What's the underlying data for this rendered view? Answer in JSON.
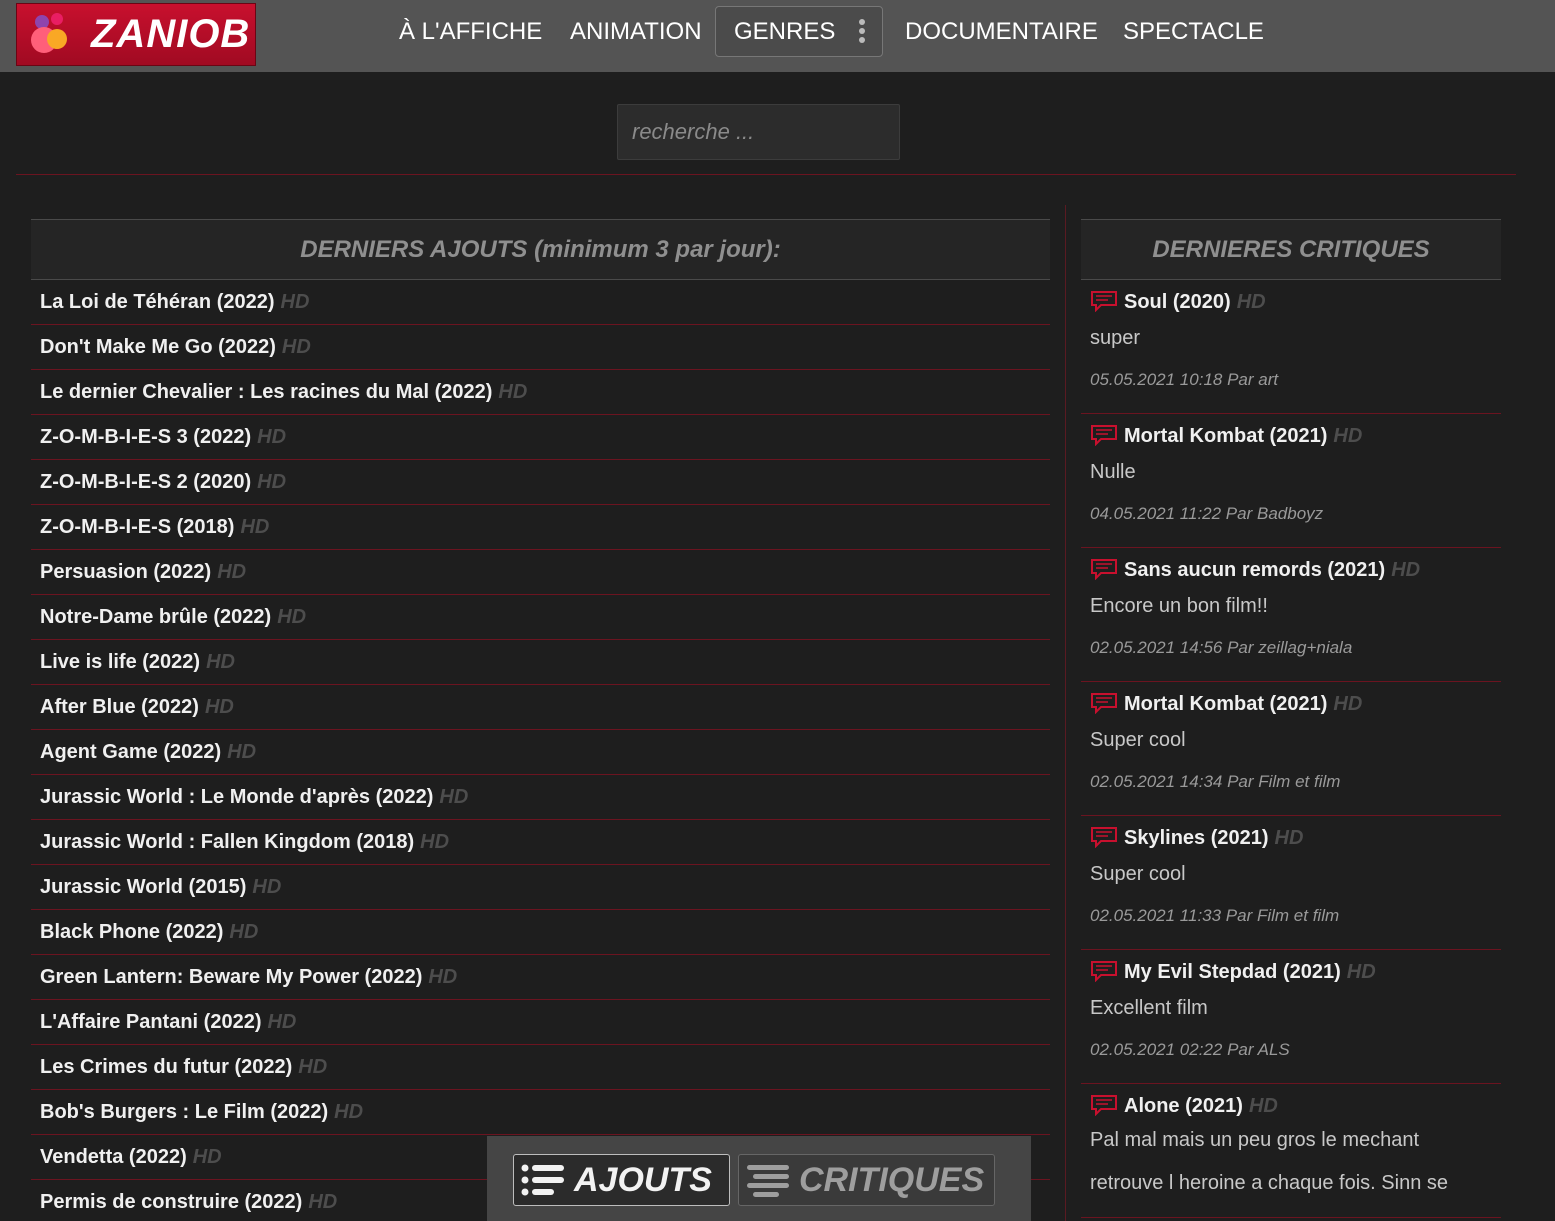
{
  "brand": {
    "name": "ZANIOB"
  },
  "nav": {
    "affiche": "À L'AFFICHE",
    "animation": "ANIMATION",
    "genres": "GENRES",
    "documentaire": "DOCUMENTAIRE",
    "spectacle": "SPECTACLE"
  },
  "search": {
    "placeholder": "recherche ..."
  },
  "additions": {
    "heading": "DERNIERS AJOUTS (minimum 3 par jour):",
    "items": [
      {
        "title": "La Loi de Téhéran (2022)",
        "quality": "HD"
      },
      {
        "title": "Don't Make Me Go (2022)",
        "quality": "HD"
      },
      {
        "title": "Le dernier Chevalier : Les racines du Mal (2022)",
        "quality": "HD"
      },
      {
        "title": "Z-O-M-B-I-E-S 3 (2022)",
        "quality": "HD"
      },
      {
        "title": "Z-O-M-B-I-E-S 2 (2020)",
        "quality": "HD"
      },
      {
        "title": "Z-O-M-B-I-E-S (2018)",
        "quality": "HD"
      },
      {
        "title": "Persuasion (2022)",
        "quality": "HD"
      },
      {
        "title": "Notre-Dame brûle (2022)",
        "quality": "HD"
      },
      {
        "title": "Live is life (2022)",
        "quality": "HD"
      },
      {
        "title": "After Blue (2022)",
        "quality": "HD"
      },
      {
        "title": "Agent Game (2022)",
        "quality": "HD"
      },
      {
        "title": "Jurassic World : Le Monde d'après (2022)",
        "quality": "HD"
      },
      {
        "title": "Jurassic World : Fallen Kingdom (2018)",
        "quality": "HD"
      },
      {
        "title": "Jurassic World (2015)",
        "quality": "HD"
      },
      {
        "title": "Black Phone (2022)",
        "quality": "HD"
      },
      {
        "title": "Green Lantern: Beware My Power (2022)",
        "quality": "HD"
      },
      {
        "title": "L'Affaire Pantani (2022)",
        "quality": "HD"
      },
      {
        "title": "Les Crimes du futur (2022)",
        "quality": "HD"
      },
      {
        "title": "Bob's Burgers : Le Film (2022)",
        "quality": "HD"
      },
      {
        "title": "Vendetta (2022)",
        "quality": "HD"
      },
      {
        "title": "Permis de construire (2022)",
        "quality": "HD"
      }
    ]
  },
  "reviews": {
    "heading": "DERNIERES CRITIQUES",
    "items": [
      {
        "title": "Soul (2020)",
        "quality": "HD",
        "text": "super",
        "meta": "05.05.2021 10:18 Par art"
      },
      {
        "title": "Mortal Kombat (2021)",
        "quality": "HD",
        "text": "Nulle",
        "meta": "04.05.2021 11:22 Par Badboyz"
      },
      {
        "title": "Sans aucun remords (2021)",
        "quality": "HD",
        "text": "Encore un bon film!!",
        "meta": "02.05.2021 14:56 Par zeillag+niala"
      },
      {
        "title": "Mortal Kombat (2021)",
        "quality": "HD",
        "text": "Super cool",
        "meta": "02.05.2021 14:34 Par Film et film"
      },
      {
        "title": "Skylines (2021)",
        "quality": "HD",
        "text": "Super cool",
        "meta": "02.05.2021 11:33 Par Film et film"
      },
      {
        "title": "My Evil Stepdad (2021)",
        "quality": "HD",
        "text": "Excellent film",
        "meta": "02.05.2021 02:22 Par ALS"
      },
      {
        "title": "Alone (2021)",
        "quality": "HD",
        "text": "Pal mal mais un peu gros le mechant retrouve l heroine a chaque fois. Sinn se"
      }
    ]
  },
  "bottom_bar": {
    "ajouts": "AJOUTS",
    "critiques": "CRITIQUES"
  },
  "colors": {
    "accent": "#c8102e",
    "separator": "#6b1420",
    "topbar": "#545454",
    "background": "#1e1e1e"
  }
}
